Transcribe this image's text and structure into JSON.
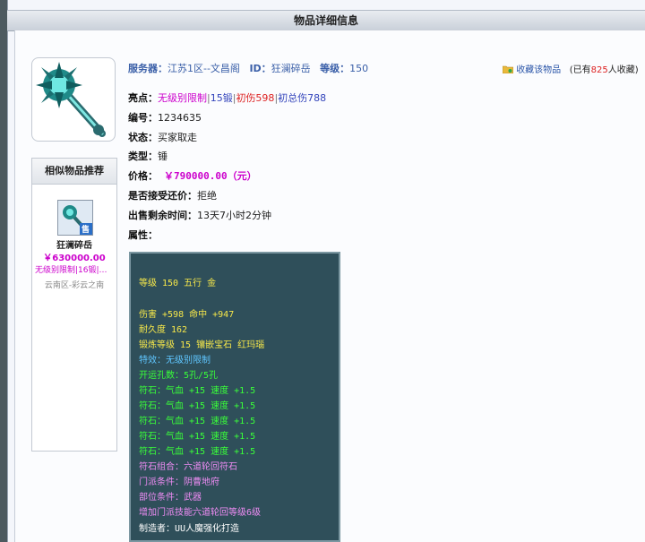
{
  "window": {
    "title": "物品详细信息"
  },
  "item": {
    "server_label": "服务器：",
    "server": "江苏1区--文昌阁",
    "id_label": "ID：",
    "id_value": "狂澜碎岳",
    "level_label": "等级：",
    "level": "150",
    "favorite_link": "收藏该物品",
    "favorite_prefix": "(已有",
    "favorite_count": "825",
    "favorite_suffix": "人收藏)",
    "highlights_label": "亮点：",
    "highlights": [
      "无级别限制",
      "|",
      "15锻",
      "|",
      "初伤598",
      "|",
      "初总伤788"
    ],
    "serial_label": "编号：",
    "serial": "1234635",
    "status_label": "状态：",
    "status": "买家取走",
    "type_label": "类型：",
    "type": "锤",
    "price_label": "价格：",
    "price": "￥790000.00（元）",
    "counter_label": "是否接受还价：",
    "counter": "拒绝",
    "remaining_label": "出售剩余时间：",
    "remaining": "13天7小时2分钟",
    "attr_label": "属性："
  },
  "similar": {
    "title": "相似物品推荐",
    "item_name": "狂澜碎岳",
    "item_price": "￥630000.00",
    "item_desc": "无级别限制|16锻|…",
    "item_server": "云南区-彩云之南",
    "sale_badge": "售"
  },
  "tooltip": {
    "lines": [
      "等级 150 五行 金",
      "伤害 +598 命中 +947",
      "耐久度 162",
      "锻炼等级 15 镶嵌宝石 红玛瑙",
      "特效：无级别限制",
      "开运孔数：5孔/5孔",
      "符石：气血 +15 速度 +1.5",
      "符石：气血 +15 速度 +1.5",
      "符石：气血 +15 速度 +1.5",
      "符石：气血 +15 速度 +1.5",
      "符石：气血 +15 速度 +1.5",
      "符石组合：六道轮回符石",
      "门派条件：阴曹地府",
      "部位条件：武器",
      "增加门派技能六道轮回等级6级",
      "制造者：UU人魔强化打造"
    ]
  },
  "colors": {
    "magenta": "#cc00cc",
    "blue": "#3344bb",
    "red": "#dd2222",
    "tooltip_bg": "#2f4f5a",
    "yellow": "#f7e84a",
    "cyan": "#5fc6ff",
    "green": "#39ff39",
    "pink": "#f08cf5"
  },
  "icons": [
    "mace-weapon-icon",
    "folder-favorite-icon",
    "sale-badge-icon"
  ]
}
